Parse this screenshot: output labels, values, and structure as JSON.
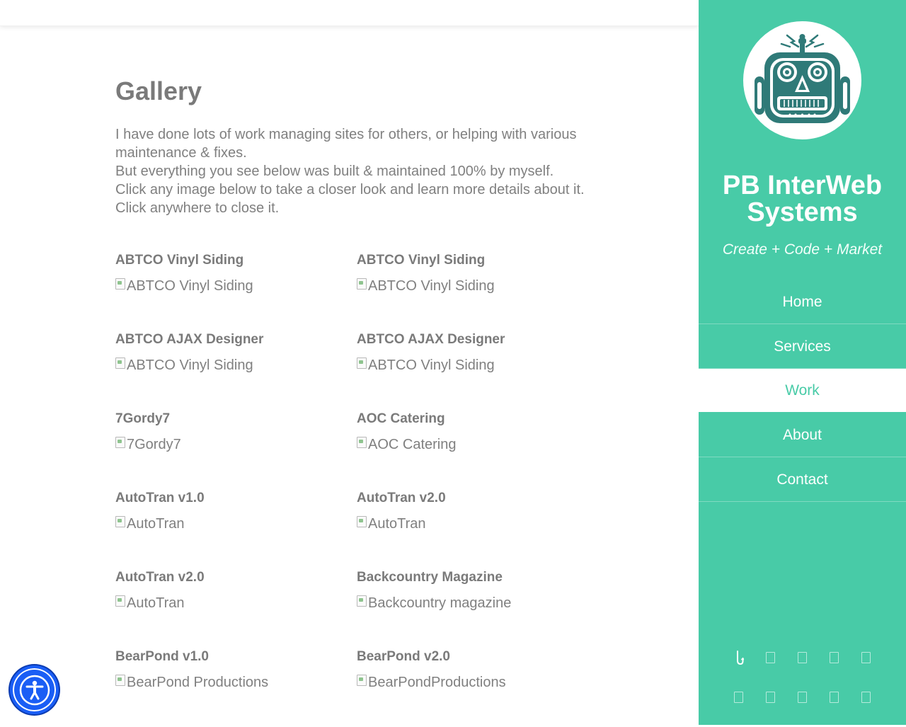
{
  "page": {
    "title": "Gallery",
    "intro": [
      "I have done lots of work managing sites for others, or helping with various maintenance & fixes.",
      "But everything you see below was built & maintained 100% by myself.",
      "Click any image below to take a closer look and learn more details about it. Click anywhere to close it."
    ]
  },
  "gallery": [
    {
      "title": "ABTCO Vinyl Siding",
      "alt": "ABTCO Vinyl Siding"
    },
    {
      "title": "ABTCO Vinyl Siding",
      "alt": "ABTCO Vinyl Siding"
    },
    {
      "title": "ABTCO AJAX Designer",
      "alt": "ABTCO Vinyl Siding"
    },
    {
      "title": "ABTCO AJAX Designer",
      "alt": "ABTCO Vinyl Siding"
    },
    {
      "title": "7Gordy7",
      "alt": "7Gordy7"
    },
    {
      "title": "AOC Catering",
      "alt": "AOC Catering"
    },
    {
      "title": "AutoTran v1.0",
      "alt": "AutoTran"
    },
    {
      "title": "AutoTran v2.0",
      "alt": "AutoTran"
    },
    {
      "title": "AutoTran v2.0",
      "alt": "AutoTran"
    },
    {
      "title": "Backcountry Magazine",
      "alt": "Backcountry magazine"
    },
    {
      "title": "BearPond v1.0",
      "alt": "BearPond Productions"
    },
    {
      "title": "BearPond v2.0",
      "alt": "BearPondProductions"
    }
  ],
  "sidebar": {
    "brand_name": "PB InterWeb Systems",
    "tagline": "Create + Code + Market",
    "nav": [
      {
        "label": "Home",
        "active": false
      },
      {
        "label": "Services",
        "active": false
      },
      {
        "label": "Work",
        "active": true
      },
      {
        "label": "About",
        "active": false
      },
      {
        "label": "Contact",
        "active": false
      }
    ],
    "social_icons_row1": [
      "hook-icon",
      "social-icon",
      "social-icon",
      "social-icon",
      "social-icon"
    ],
    "social_icons_row2": [
      "social-icon",
      "social-icon",
      "social-icon",
      "social-icon",
      "social-icon"
    ]
  },
  "colors": {
    "accent": "#48cba7",
    "text": "#808080",
    "a11y": "#1a5ef5"
  },
  "icons": {
    "logo": "robot-logo-icon",
    "accessibility": "accessibility-icon",
    "broken_image": "broken-image-icon"
  }
}
